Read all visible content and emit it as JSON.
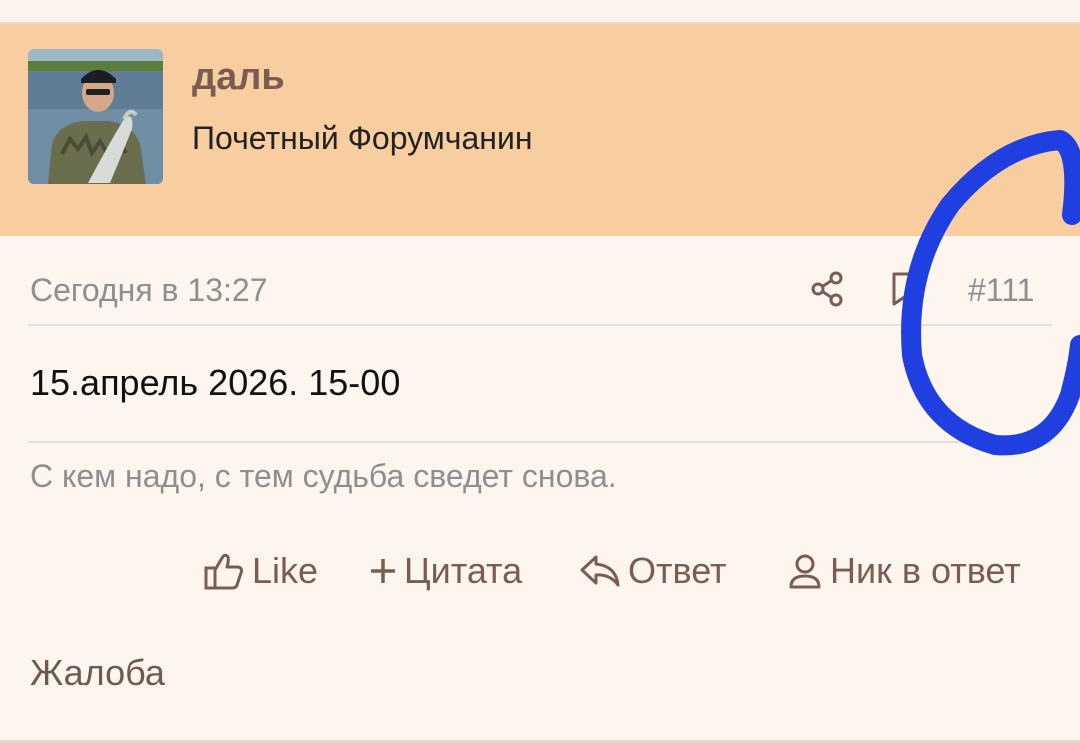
{
  "user": {
    "name": "даль",
    "title": "Почетный Форумчанин",
    "avatar": "user-avatar-photo"
  },
  "post": {
    "date": "Сегодня в 13:27",
    "number": "#111",
    "message": "15.апрель 2026. 15-00",
    "signature": "С кем надо, с тем судьба сведет снова."
  },
  "icons": {
    "share": "share-icon",
    "bookmark": "bookmark-icon",
    "like": "thumbs-up-icon",
    "quote": "plus-icon",
    "reply": "reply-icon",
    "nick": "user-icon"
  },
  "actions": {
    "like": "Like",
    "quote": "Цитата",
    "reply": "Ответ",
    "nick": "Ник в ответ"
  },
  "report": "Жалоба",
  "colors": {
    "header_bg": "#f8cd9f",
    "body_bg": "#fdf5ee",
    "accent": "#7a5c52",
    "muted": "#8f8f8f",
    "scribble": "#1f3fe0"
  }
}
